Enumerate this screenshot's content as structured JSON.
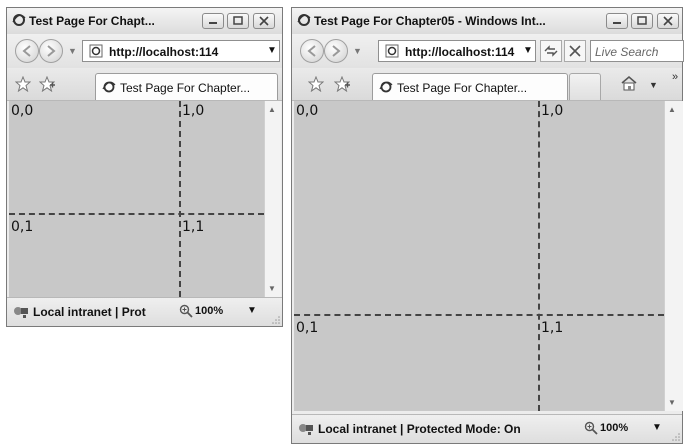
{
  "windows": [
    {
      "title": "Test Page For Chapt...",
      "address": "http://localhost:114",
      "tab_label": "Test Page For Chapter...",
      "status_text": "Local intranet | Prot",
      "zoom": "100%",
      "grid_labels": [
        "0,0",
        "1,0",
        "0,1",
        "1,1"
      ]
    },
    {
      "title": "Test Page For Chapter05 - Windows Int...",
      "address": "http://localhost:114",
      "search_placeholder": "Live Search",
      "tab_label": "Test Page For Chapter...",
      "tab_more": "»",
      "status_text": "Local intranet | Protected Mode: On",
      "zoom": "100%",
      "grid_labels": [
        "0,0",
        "1,0",
        "0,1",
        "1,1"
      ]
    }
  ],
  "colors": {
    "content_bg": "#c8c8c8",
    "grid_line": "#444444",
    "ie_blue": "#2a62c9"
  }
}
